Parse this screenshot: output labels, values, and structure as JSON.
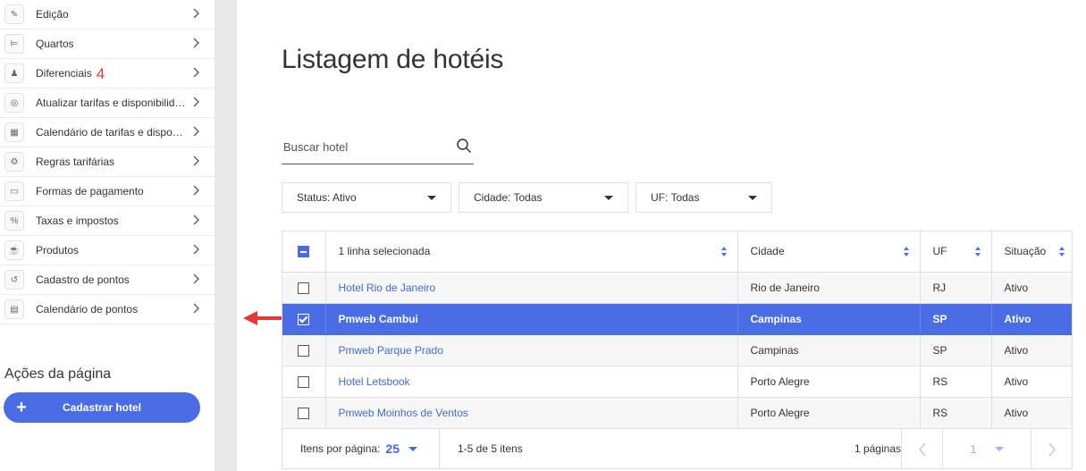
{
  "sidebar": {
    "items": [
      {
        "label": "Edição",
        "icon": "pencil-icon",
        "glyph": "✎"
      },
      {
        "label": "Quartos",
        "icon": "bed-icon",
        "glyph": "⊨"
      },
      {
        "label": "Diferenciais",
        "icon": "bag-icon",
        "glyph": "♟",
        "badge": "4"
      },
      {
        "label": "Atualizar tarifas e disponibilida...",
        "icon": "target-icon",
        "glyph": "◎"
      },
      {
        "label": "Calendário de tarifas e disponi...",
        "icon": "grid-icon",
        "glyph": "▦"
      },
      {
        "label": "Regras tarifárias",
        "icon": "gears-icon",
        "glyph": "⚙"
      },
      {
        "label": "Formas de pagamento",
        "icon": "wallet-icon",
        "glyph": "▭"
      },
      {
        "label": "Taxas e impostos",
        "icon": "percent-icon",
        "glyph": "%"
      },
      {
        "label": "Produtos",
        "icon": "products-icon",
        "glyph": "☕"
      },
      {
        "label": "Cadastro de pontos",
        "icon": "refresh-icon",
        "glyph": "↺"
      },
      {
        "label": "Calendário de pontos",
        "icon": "calendar-icon",
        "glyph": "▤"
      }
    ],
    "actions_title": "Ações da página",
    "primary_action": {
      "icon": "+",
      "label": "Cadastrar hotel"
    }
  },
  "main": {
    "title": "Listagem de hotéis",
    "search": {
      "placeholder": "Buscar hotel"
    },
    "filters": [
      {
        "label": "Status: Ativo"
      },
      {
        "label": "Cidade: Todas"
      },
      {
        "label": "UF: Todas"
      }
    ]
  },
  "table": {
    "headers": {
      "selection": "1 linha selecionada",
      "city": "Cidade",
      "state": "UF",
      "status": "Situação"
    },
    "rows": [
      {
        "name": "Hotel Rio de Janeiro",
        "city": "Rio de Janeiro",
        "state": "RJ",
        "status": "Ativo",
        "checked": false
      },
      {
        "name": "Pmweb Cambui",
        "city": "Campinas",
        "state": "SP",
        "status": "Ativo",
        "checked": true
      },
      {
        "name": "Pmweb Parque Prado",
        "city": "Campinas",
        "state": "SP",
        "status": "Ativo",
        "checked": false
      },
      {
        "name": "Hotel Letsbook",
        "city": "Porto Alegre",
        "state": "RS",
        "status": "Ativo",
        "checked": false
      },
      {
        "name": "Pmweb Moinhos de Ventos",
        "city": "Porto Alegre",
        "state": "RS",
        "status": "Ativo",
        "checked": false
      }
    ],
    "footer": {
      "per_page_label": "Itens por página:",
      "per_page_value": "25",
      "range": "1-5 de 5 itens",
      "pages": "1 páginas",
      "current_page": "1"
    }
  },
  "colors": {
    "accent": "#4a6de5",
    "link": "#3f6ad8",
    "annotation": "#e53935"
  }
}
